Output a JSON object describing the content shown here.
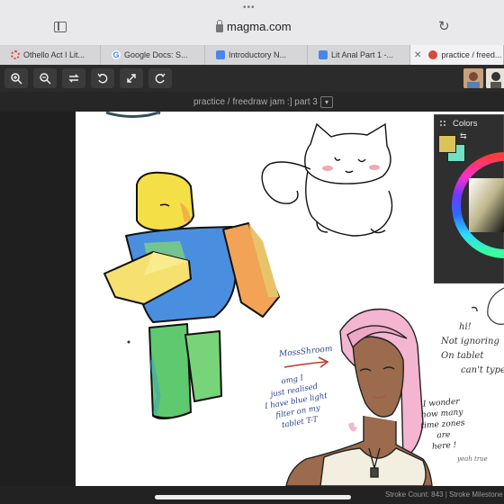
{
  "browser": {
    "url": "magma.com",
    "tabs": [
      {
        "label": "Othello Act I Lit...",
        "favicon_color": "#e04848",
        "icon": "spinner-icon"
      },
      {
        "label": "Google Docs: S...",
        "favicon_color": "#4a86e8",
        "icon": "google-icon"
      },
      {
        "label": "Introductory N...",
        "favicon_color": "#4a86e8",
        "icon": "docs-icon"
      },
      {
        "label": "Lit Anal Part 1 -...",
        "favicon_color": "#4a86e8",
        "icon": "docs-icon"
      },
      {
        "label": "practice / freed...",
        "favicon_color": "#d84a3a",
        "icon": "magma-icon",
        "active": true
      }
    ]
  },
  "toolbar": {
    "buttons": [
      "zoom-in-icon",
      "zoom-out-icon",
      "swap-icon",
      "undo-icon",
      "fit-icon",
      "redo-icon"
    ]
  },
  "document": {
    "title": "practice / freedraw jam :] part 3",
    "caret": "▾"
  },
  "colors_panel": {
    "title": "Colors",
    "primary_color": "#d9c35a",
    "secondary_color": "#6fe0c4"
  },
  "drawing_text": {
    "moss": "MossShroom",
    "omg": [
      "omg I",
      "just realised",
      "I have blue light",
      "filter on my",
      "tablet T-T"
    ],
    "wonder": [
      "I wonder",
      "how many",
      "time zones",
      "are",
      "here !"
    ],
    "hi": [
      "hi!",
      "Not ignoring",
      "On tablet",
      "can't type"
    ],
    "yeah": "yeah true"
  },
  "status": {
    "text": "Stroke Count: 843 | Stroke Milestone"
  }
}
